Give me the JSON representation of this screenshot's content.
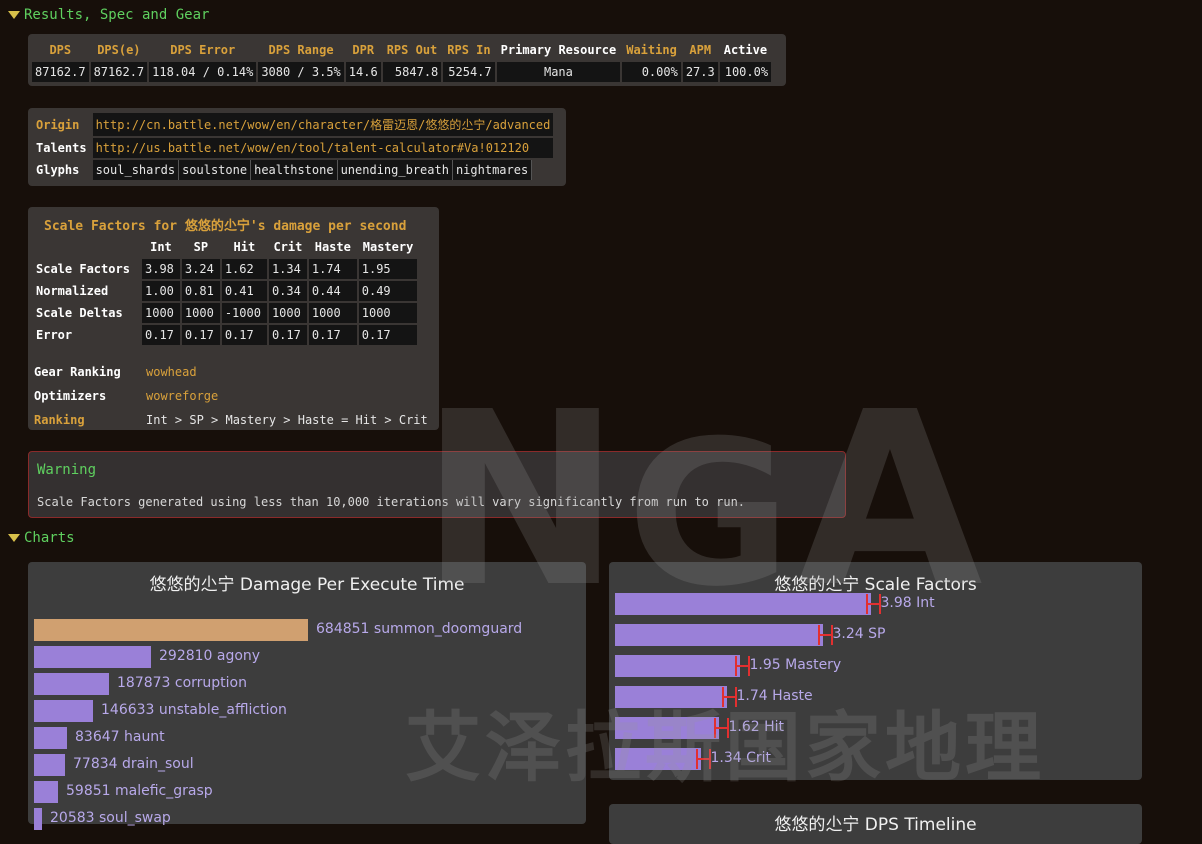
{
  "sections": {
    "results": "Results, Spec and Gear",
    "charts": "Charts"
  },
  "results_table": {
    "headers": [
      {
        "text": "DPS",
        "gold": true
      },
      {
        "text": "DPS(e)",
        "gold": true
      },
      {
        "text": "DPS Error",
        "gold": true
      },
      {
        "text": "DPS Range",
        "gold": true
      },
      {
        "text": "DPR",
        "gold": true
      },
      {
        "text": "RPS Out",
        "gold": true
      },
      {
        "text": "RPS In",
        "gold": true
      },
      {
        "text": "Primary Resource",
        "gold": false
      },
      {
        "text": "Waiting",
        "gold": true
      },
      {
        "text": "APM",
        "gold": true
      },
      {
        "text": "Active",
        "gold": false
      }
    ],
    "values": [
      "87162.7",
      "87162.7",
      "118.04 / 0.14%",
      "3080 / 3.5%",
      "14.6",
      "5847.8",
      "5254.7",
      "Mana",
      "0.00%",
      "27.3",
      "100.0%"
    ]
  },
  "info": {
    "origin_label": "Origin",
    "origin_value": "http://cn.battle.net/wow/en/character/格雷迈恩/悠悠的尐宁/advanced",
    "talents_label": "Talents",
    "talents_value": "http://us.battle.net/wow/en/tool/talent-calculator#Va!012120",
    "glyphs_label": "Glyphs",
    "glyphs": [
      "soul_shards",
      "soulstone",
      "healthstone",
      "unending_breath",
      "nightmares"
    ]
  },
  "scale_factors": {
    "title": "Scale Factors for 悠悠的尐宁's damage per second",
    "columns": [
      "Int",
      "SP",
      "Hit",
      "Crit",
      "Haste",
      "Mastery"
    ],
    "rows": [
      {
        "label": "Scale Factors",
        "values": [
          "3.98",
          "3.24",
          "1.62",
          "1.34",
          "1.74",
          "1.95"
        ]
      },
      {
        "label": "Normalized",
        "values": [
          "1.00",
          "0.81",
          "0.41",
          "0.34",
          "0.44",
          "0.49"
        ]
      },
      {
        "label": "Scale Deltas",
        "values": [
          "1000",
          "1000",
          "-1000",
          "1000",
          "1000",
          "1000"
        ]
      },
      {
        "label": "Error",
        "values": [
          "0.17",
          "0.17",
          "0.17",
          "0.17",
          "0.17",
          "0.17"
        ]
      }
    ],
    "gear_ranking_label": "Gear Ranking",
    "gear_ranking_value": "wowhead",
    "optimizers_label": "Optimizers",
    "optimizers_value": "wowreforge",
    "ranking_label": "Ranking",
    "ranking_value": "Int > SP > Mastery > Haste = Hit > Crit"
  },
  "warning": {
    "title": "Warning",
    "text": "Scale Factors generated using less than 10,000 iterations will vary significantly from run to run."
  },
  "dpe_chart": {
    "title": "悠悠的尐宁 Damage Per Execute Time",
    "bars": [
      {
        "value": 684851,
        "label": "684851  summon_doomguard",
        "color": "#d0a070"
      },
      {
        "value": 292810,
        "label": "292810  agony",
        "color": "#9a80d8"
      },
      {
        "value": 187873,
        "label": "187873  corruption",
        "color": "#9a80d8"
      },
      {
        "value": 146633,
        "label": "146633  unstable_affliction",
        "color": "#9a80d8"
      },
      {
        "value": 83647,
        "label": "83647  haunt",
        "color": "#9a80d8"
      },
      {
        "value": 77834,
        "label": "77834  drain_soul",
        "color": "#9a80d8"
      },
      {
        "value": 59851,
        "label": "59851  malefic_grasp",
        "color": "#9a80d8"
      },
      {
        "value": 20583,
        "label": "20583  soul_swap",
        "color": "#9a80d8"
      }
    ]
  },
  "sf_chart": {
    "title": "悠悠的尐宁 Scale Factors",
    "bars": [
      {
        "value": 3.98,
        "label": "3.98  Int"
      },
      {
        "value": 3.24,
        "label": "3.24  SP"
      },
      {
        "value": 1.95,
        "label": "1.95  Mastery"
      },
      {
        "value": 1.74,
        "label": "1.74  Haste"
      },
      {
        "value": 1.62,
        "label": "1.62  Hit"
      },
      {
        "value": 1.34,
        "label": "1.34  Crit"
      }
    ],
    "error": 0.17
  },
  "timeline_chart": {
    "title": "悠悠的尐宁 DPS Timeline"
  },
  "watermark": {
    "logo": "NGA",
    "caption": "艾泽拉斯国家地理"
  }
}
